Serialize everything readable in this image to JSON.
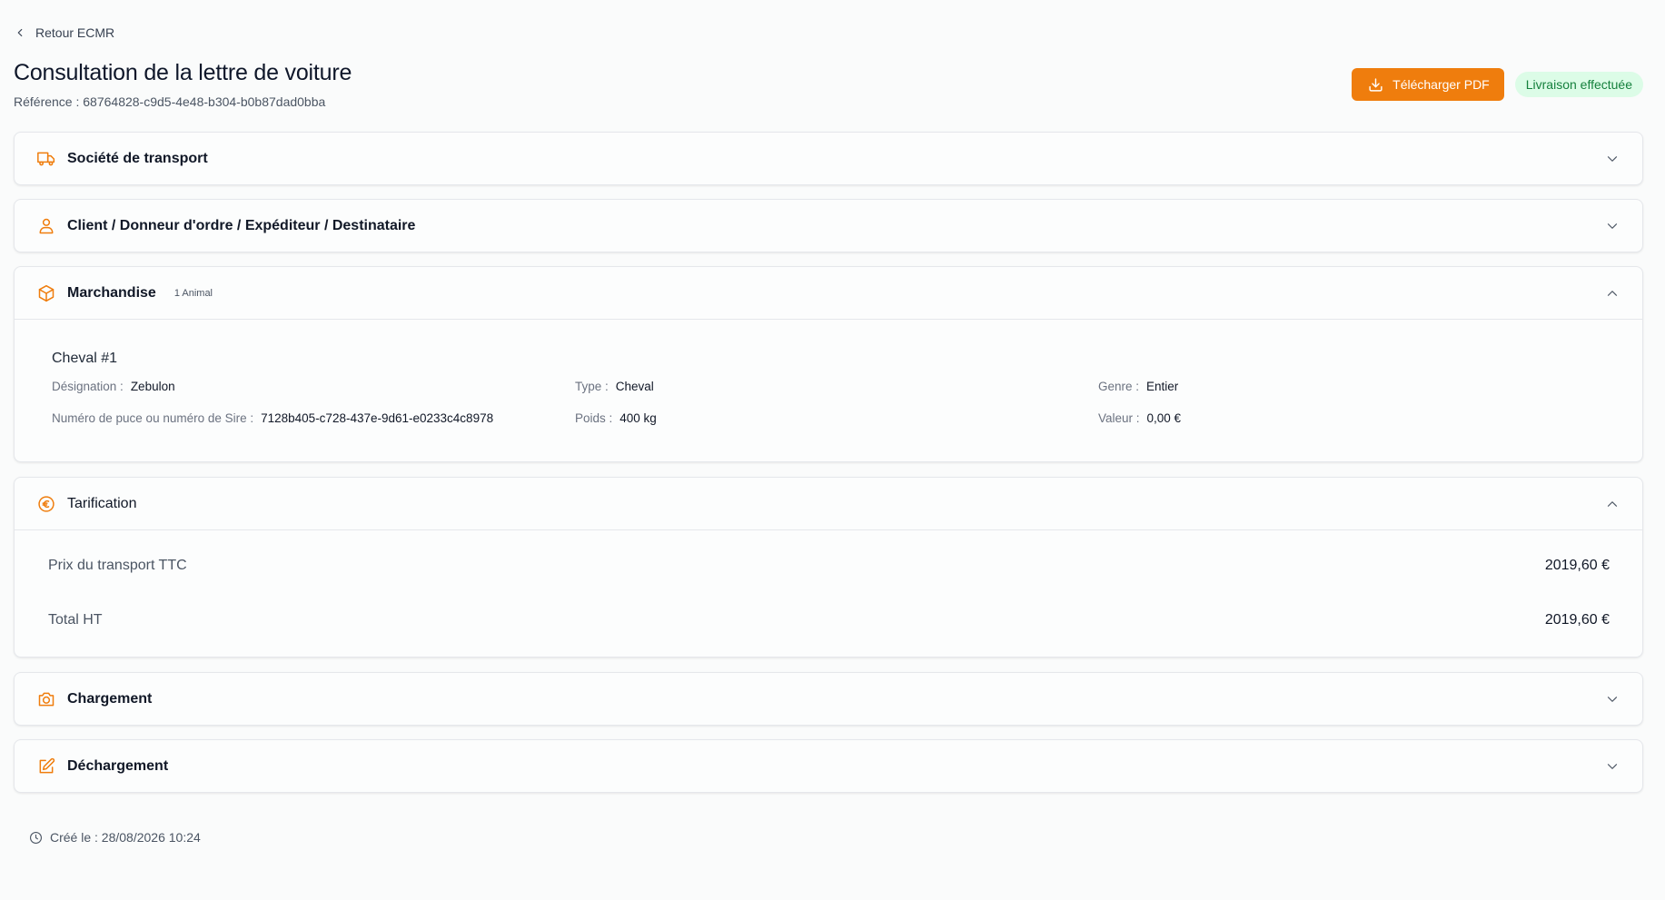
{
  "nav": {
    "back_label": "Retour ECMR"
  },
  "header": {
    "title": "Consultation de la lettre de voiture",
    "reference": "Référence : 68764828-c9d5-4e48-b304-b0b87dad0bba",
    "download_label": "Télécharger PDF",
    "status_label": "Livraison effectuée"
  },
  "sections": {
    "transport": {
      "title": "Société de transport",
      "icon": "truck-icon",
      "expanded": false
    },
    "client": {
      "title": "Client / Donneur d'ordre / Expéditeur / Destinataire",
      "icon": "user-icon",
      "expanded": false
    },
    "merchandise": {
      "title": "Marchandise",
      "count": "1 Animal",
      "icon": "package-icon",
      "expanded": true,
      "animals": [
        {
          "title": "Cheval #1",
          "fields": [
            {
              "label": "Désignation :",
              "value": "Zebulon"
            },
            {
              "label": "Type :",
              "value": "Cheval"
            },
            {
              "label": "Genre :",
              "value": "Entier"
            },
            {
              "label": "Numéro de puce ou numéro de Sire :",
              "value": "7128b405-c728-437e-9d61-e0233c4c8978"
            },
            {
              "label": "Poids :",
              "value": "400 kg"
            },
            {
              "label": "Valeur :",
              "value": "0,00 €"
            }
          ]
        }
      ]
    },
    "pricing": {
      "title": "Tarification",
      "icon": "euro-icon",
      "expanded": true,
      "rows": [
        {
          "label": "Prix du transport TTC",
          "value": "2019,60 €"
        },
        {
          "label": "Total HT",
          "value": "2019,60 €"
        }
      ]
    },
    "loading": {
      "title": "Chargement",
      "icon": "camera-icon",
      "expanded": false
    },
    "unloading": {
      "title": "Déchargement",
      "icon": "edit-icon",
      "expanded": false
    }
  },
  "footer": {
    "created": "Créé le : 28/08/2026 10:24"
  },
  "colors": {
    "accent": "#ef7d0d",
    "status_bg": "#dcfce7",
    "status_text": "#15803d"
  }
}
